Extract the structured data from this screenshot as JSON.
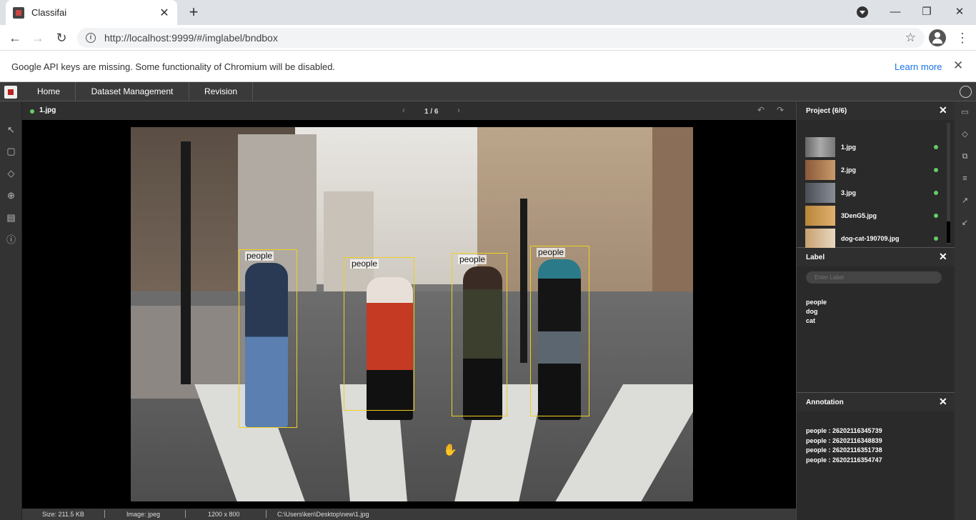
{
  "browser": {
    "tab_title": "Classifai",
    "tab_close": "✕",
    "new_tab": "+",
    "url": "http://localhost:9999/#/imglabel/bndbox",
    "infobar_message": "Google API keys are missing. Some functionality of Chromium will be disabled.",
    "learn_more": "Learn more",
    "infobar_close": "✕",
    "minimize": "—",
    "restore": "❐",
    "close": "✕"
  },
  "app": {
    "menu": [
      "Home",
      "Dataset Management",
      "Revision"
    ],
    "viewer": {
      "filename": "1.jpg",
      "page": "1 / 6"
    },
    "boxes": [
      {
        "label": "people"
      },
      {
        "label": "people"
      },
      {
        "label": "people"
      },
      {
        "label": "people"
      }
    ],
    "status": {
      "size": "Size: 211.5 KB",
      "image": "Image: jpeg",
      "dims": "1200 x 800",
      "path": "C:\\Users\\ken\\Desktop\\new\\1.jpg"
    },
    "project": {
      "title": "Project (6/6)",
      "items": [
        {
          "name": "1.jpg"
        },
        {
          "name": "2.jpg"
        },
        {
          "name": "3.jpg"
        },
        {
          "name": "3DenG5.jpg"
        },
        {
          "name": "dog-cat-190709.jpg"
        }
      ]
    },
    "label_panel": {
      "title": "Label",
      "placeholder": "Enter Label",
      "labels": [
        "people",
        "dog",
        "cat"
      ]
    },
    "annotation_panel": {
      "title": "Annotation",
      "items": [
        "people : 26202116345739",
        "people : 26202116348839",
        "people : 26202116351738",
        "people : 26202116354747"
      ]
    },
    "accent_color": "#f0d020",
    "status_dot_color": "#66cc66"
  },
  "icons": {
    "pointer": "pointer-icon",
    "bbox": "bounding-box-icon",
    "tag": "tag-icon",
    "crosshair": "crosshair-icon",
    "save": "save-icon",
    "info": "info-icon"
  }
}
